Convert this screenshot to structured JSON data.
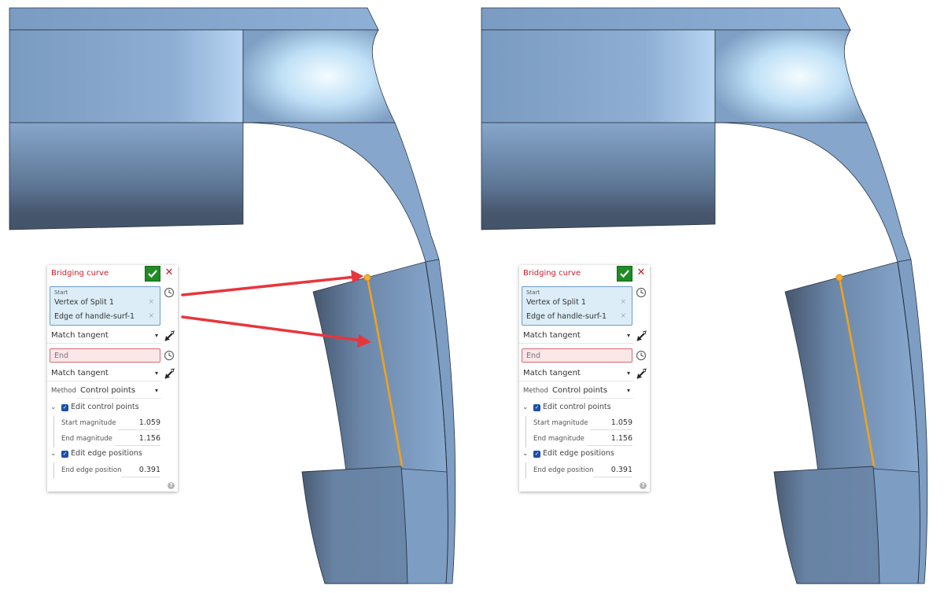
{
  "colors": {
    "model_light": "#86a8cf",
    "model_dark": "#44566e",
    "edge": "#1f2a38",
    "highlight": "#f0a21a",
    "arrow": "#e8353c",
    "ok_green": "#1f8b24",
    "title_red": "#c8202e"
  },
  "panels": [
    {
      "title": "Bridging curve",
      "ok_icon": "checkmark-icon",
      "close_icon": "close-icon",
      "start": {
        "label": "Start",
        "items": [
          {
            "label": "Vertex of Split 1",
            "remove": "×"
          },
          {
            "label": "Edge of handle-surf-1",
            "remove": "×"
          }
        ]
      },
      "start_condition": {
        "value": "Match tangent",
        "caret": "▾"
      },
      "end": {
        "placeholder": "End"
      },
      "end_condition": {
        "value": "Match tangent",
        "caret": "▾"
      },
      "method": {
        "label": "Method",
        "value": "Control points",
        "caret": "▾"
      },
      "edit_control_points": {
        "label": "Edit control points",
        "checked": true,
        "chevron": "⌄",
        "check": "✓",
        "fields": [
          {
            "label": "Start magnitude",
            "value": "1.059"
          },
          {
            "label": "End magnitude",
            "value": "1.156"
          }
        ]
      },
      "edit_edge_positions": {
        "label": "Edit edge positions",
        "checked": true,
        "chevron": "⌄",
        "check": "✓",
        "fields": [
          {
            "label": "End edge position",
            "value": "0.391"
          }
        ]
      },
      "help": "?"
    },
    {
      "title": "Bridging curve",
      "ok_icon": "checkmark-icon",
      "close_icon": "close-icon",
      "start": {
        "label": "Start",
        "items": [
          {
            "label": "Vertex of Split 1",
            "remove": "×"
          },
          {
            "label": "Edge of handle-surf-1",
            "remove": "×"
          }
        ]
      },
      "start_condition": {
        "value": "Match tangent",
        "caret": "▾"
      },
      "end": {
        "placeholder": "End"
      },
      "end_condition": {
        "value": "Match tangent",
        "caret": "▾"
      },
      "method": {
        "label": "Method",
        "value": "Control points",
        "caret": "▾"
      },
      "edit_control_points": {
        "label": "Edit control points",
        "checked": true,
        "chevron": "⌄",
        "check": "✓",
        "fields": [
          {
            "label": "Start magnitude",
            "value": "1.059"
          },
          {
            "label": "End magnitude",
            "value": "1.156"
          }
        ]
      },
      "edit_edge_positions": {
        "label": "Edit edge positions",
        "checked": true,
        "chevron": "⌄",
        "check": "✓",
        "fields": [
          {
            "label": "End edge position",
            "value": "0.391"
          }
        ]
      },
      "help": "?"
    }
  ],
  "annotations": {
    "left_view_arrows": [
      "arrow-to-vertex",
      "arrow-to-edge"
    ]
  }
}
